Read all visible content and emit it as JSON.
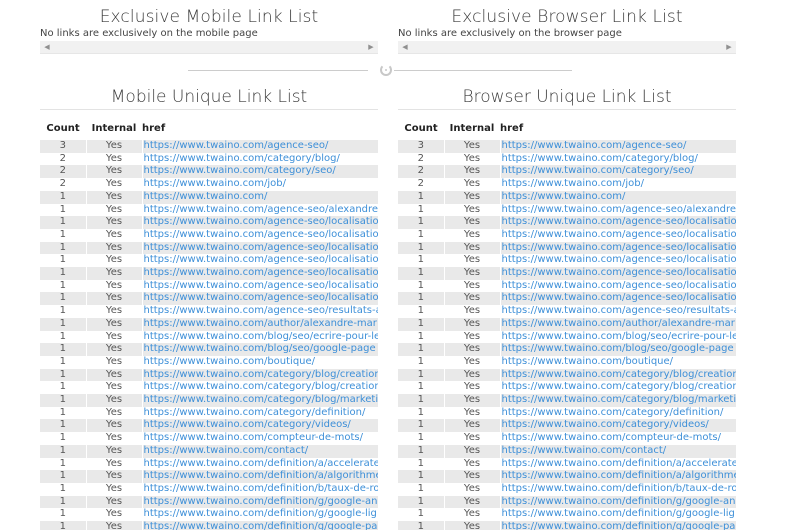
{
  "exclusive_mobile": {
    "title": "Exclusive Mobile Link List",
    "message": "No links are exclusively on the mobile page"
  },
  "exclusive_browser": {
    "title": "Exclusive Browser Link List",
    "message": "No links are exclusively on the browser page"
  },
  "mobile_unique": {
    "title": "Mobile Unique Link List",
    "columns": [
      "Count",
      "Internal",
      "href"
    ],
    "rows": [
      [
        "3",
        "Yes",
        "https://www.twaino.com/agence-seo/"
      ],
      [
        "2",
        "Yes",
        "https://www.twaino.com/category/blog/"
      ],
      [
        "2",
        "Yes",
        "https://www.twaino.com/category/seo/"
      ],
      [
        "2",
        "Yes",
        "https://www.twaino.com/job/"
      ],
      [
        "1",
        "Yes",
        "https://www.twaino.com/"
      ],
      [
        "1",
        "Yes",
        "https://www.twaino.com/agence-seo/alexandre"
      ],
      [
        "1",
        "Yes",
        "https://www.twaino.com/agence-seo/localisatio"
      ],
      [
        "1",
        "Yes",
        "https://www.twaino.com/agence-seo/localisatio"
      ],
      [
        "1",
        "Yes",
        "https://www.twaino.com/agence-seo/localisatio"
      ],
      [
        "1",
        "Yes",
        "https://www.twaino.com/agence-seo/localisatio"
      ],
      [
        "1",
        "Yes",
        "https://www.twaino.com/agence-seo/localisatio"
      ],
      [
        "1",
        "Yes",
        "https://www.twaino.com/agence-seo/localisatio"
      ],
      [
        "1",
        "Yes",
        "https://www.twaino.com/agence-seo/localisatio"
      ],
      [
        "1",
        "Yes",
        "https://www.twaino.com/agence-seo/resultats-a"
      ],
      [
        "1",
        "Yes",
        "https://www.twaino.com/author/alexandre-mar"
      ],
      [
        "1",
        "Yes",
        "https://www.twaino.com/blog/seo/ecrire-pour-le"
      ],
      [
        "1",
        "Yes",
        "https://www.twaino.com/blog/seo/google-page"
      ],
      [
        "1",
        "Yes",
        "https://www.twaino.com/boutique/"
      ],
      [
        "1",
        "Yes",
        "https://www.twaino.com/category/blog/creation"
      ],
      [
        "1",
        "Yes",
        "https://www.twaino.com/category/blog/creation"
      ],
      [
        "1",
        "Yes",
        "https://www.twaino.com/category/blog/marketi"
      ],
      [
        "1",
        "Yes",
        "https://www.twaino.com/category/definition/"
      ],
      [
        "1",
        "Yes",
        "https://www.twaino.com/category/videos/"
      ],
      [
        "1",
        "Yes",
        "https://www.twaino.com/compteur-de-mots/"
      ],
      [
        "1",
        "Yes",
        "https://www.twaino.com/contact/"
      ],
      [
        "1",
        "Yes",
        "https://www.twaino.com/definition/a/accelerate"
      ],
      [
        "1",
        "Yes",
        "https://www.twaino.com/definition/a/algorithme"
      ],
      [
        "1",
        "Yes",
        "https://www.twaino.com/definition/b/taux-de-ro"
      ],
      [
        "1",
        "Yes",
        "https://www.twaino.com/definition/g/google-an"
      ],
      [
        "1",
        "Yes",
        "https://www.twaino.com/definition/g/google-lig"
      ],
      [
        "1",
        "Yes",
        "https://www.twaino.com/definition/g/google-pa"
      ]
    ]
  },
  "browser_unique": {
    "title": "Browser Unique Link List",
    "columns": [
      "Count",
      "Internal",
      "href"
    ],
    "rows": [
      [
        "3",
        "Yes",
        "https://www.twaino.com/agence-seo/"
      ],
      [
        "2",
        "Yes",
        "https://www.twaino.com/category/blog/"
      ],
      [
        "2",
        "Yes",
        "https://www.twaino.com/category/seo/"
      ],
      [
        "2",
        "Yes",
        "https://www.twaino.com/job/"
      ],
      [
        "1",
        "Yes",
        "https://www.twaino.com/"
      ],
      [
        "1",
        "Yes",
        "https://www.twaino.com/agence-seo/alexandre"
      ],
      [
        "1",
        "Yes",
        "https://www.twaino.com/agence-seo/localisatio"
      ],
      [
        "1",
        "Yes",
        "https://www.twaino.com/agence-seo/localisatio"
      ],
      [
        "1",
        "Yes",
        "https://www.twaino.com/agence-seo/localisatio"
      ],
      [
        "1",
        "Yes",
        "https://www.twaino.com/agence-seo/localisatio"
      ],
      [
        "1",
        "Yes",
        "https://www.twaino.com/agence-seo/localisatio"
      ],
      [
        "1",
        "Yes",
        "https://www.twaino.com/agence-seo/localisatio"
      ],
      [
        "1",
        "Yes",
        "https://www.twaino.com/agence-seo/localisatio"
      ],
      [
        "1",
        "Yes",
        "https://www.twaino.com/agence-seo/resultats-a"
      ],
      [
        "1",
        "Yes",
        "https://www.twaino.com/author/alexandre-mar"
      ],
      [
        "1",
        "Yes",
        "https://www.twaino.com/blog/seo/ecrire-pour-le"
      ],
      [
        "1",
        "Yes",
        "https://www.twaino.com/blog/seo/google-page"
      ],
      [
        "1",
        "Yes",
        "https://www.twaino.com/boutique/"
      ],
      [
        "1",
        "Yes",
        "https://www.twaino.com/category/blog/creation"
      ],
      [
        "1",
        "Yes",
        "https://www.twaino.com/category/blog/creation"
      ],
      [
        "1",
        "Yes",
        "https://www.twaino.com/category/blog/marketi"
      ],
      [
        "1",
        "Yes",
        "https://www.twaino.com/category/definition/"
      ],
      [
        "1",
        "Yes",
        "https://www.twaino.com/category/videos/"
      ],
      [
        "1",
        "Yes",
        "https://www.twaino.com/compteur-de-mots/"
      ],
      [
        "1",
        "Yes",
        "https://www.twaino.com/contact/"
      ],
      [
        "1",
        "Yes",
        "https://www.twaino.com/definition/a/accelerate"
      ],
      [
        "1",
        "Yes",
        "https://www.twaino.com/definition/a/algorithme"
      ],
      [
        "1",
        "Yes",
        "https://www.twaino.com/definition/b/taux-de-ro"
      ],
      [
        "1",
        "Yes",
        "https://www.twaino.com/definition/g/google-an"
      ],
      [
        "1",
        "Yes",
        "https://www.twaino.com/definition/g/google-lig"
      ],
      [
        "1",
        "Yes",
        "https://www.twaino.com/definition/g/google-pa"
      ]
    ]
  },
  "icons": {
    "scroll_left": "scroll-left-arrow-icon",
    "scroll_right": "scroll-right-arrow-icon",
    "divider": "refresh-icon"
  },
  "colors": {
    "link": "#3d8fd8",
    "row_stripe": "#e9e9e9"
  }
}
